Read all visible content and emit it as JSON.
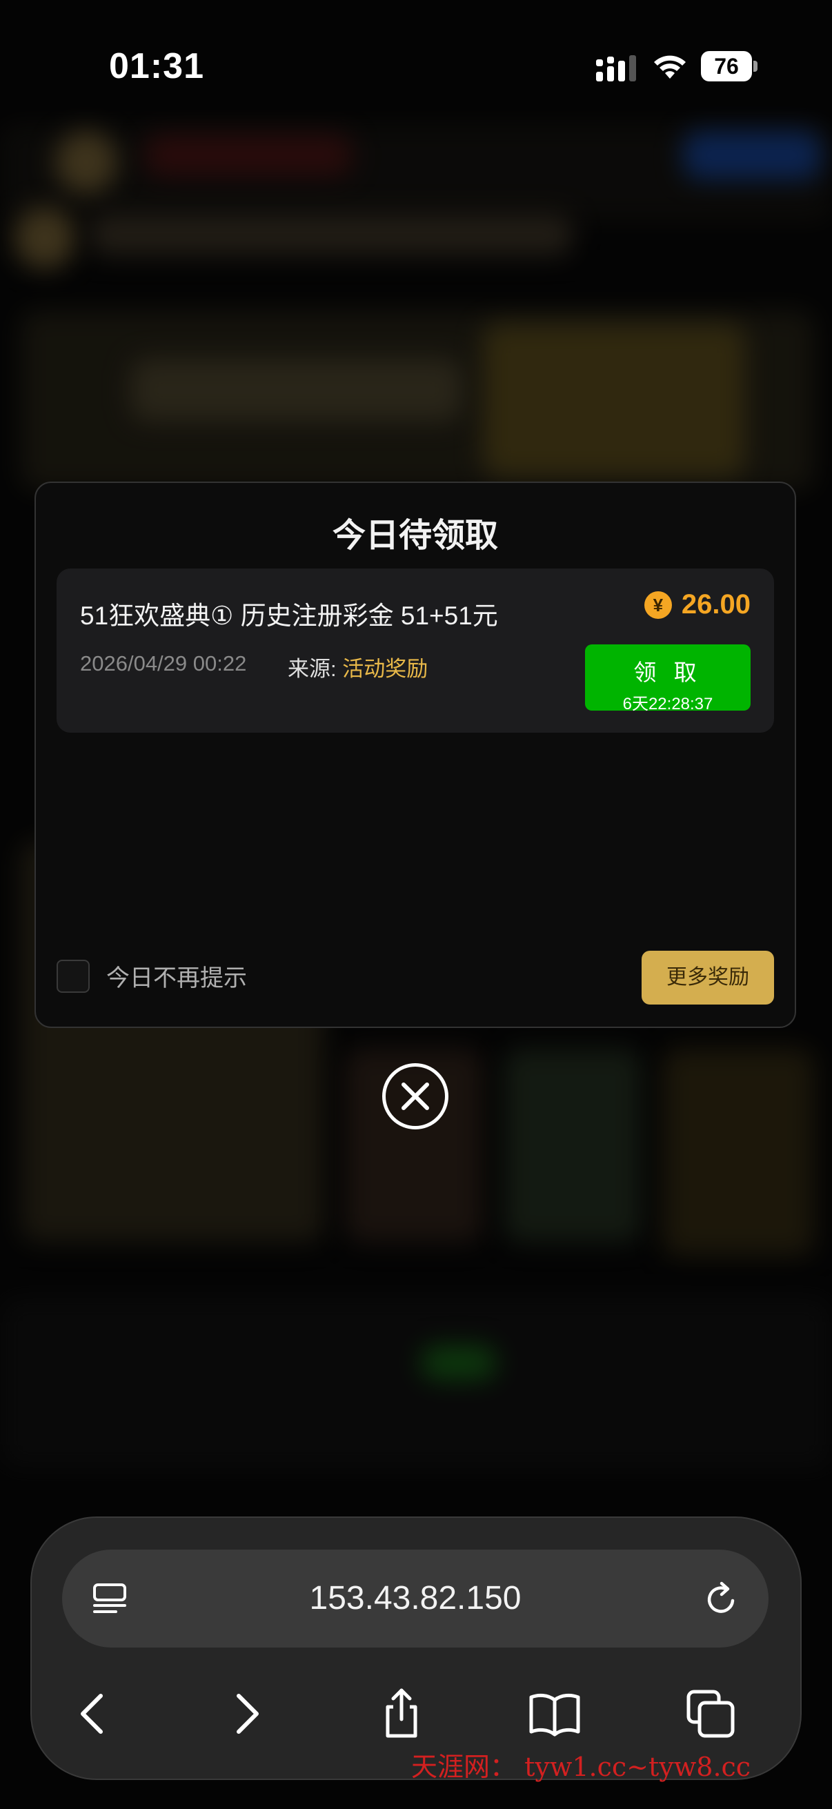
{
  "status_bar": {
    "time": "01:31",
    "battery": "76"
  },
  "modal": {
    "title": "今日待领取",
    "rewards": [
      {
        "title": "51狂欢盛典① 历史注册彩金 51+51元",
        "date": "2026/04/29 00:22",
        "source_label": "来源:",
        "source_value": "活动奖励",
        "amount": "26.00",
        "currency_icon": "¥",
        "claim_label": "领 取",
        "countdown": "6天22:28:37"
      }
    ],
    "dont_show_label": "今日不再提示",
    "more_rewards_label": "更多奖励"
  },
  "browser": {
    "url": "153.43.82.150"
  },
  "watermark": "天涯网： tyw1.cc~tyw8.cc",
  "colors": {
    "accent_gold": "#f5a623",
    "claim_green": "#00b400",
    "more_button": "#d4ae4f",
    "source_text": "#e9b949"
  },
  "icons": {
    "close": "close-icon",
    "reader": "reader-mode-icon",
    "reload": "reload-icon",
    "back": "back-icon",
    "forward": "forward-icon",
    "share": "share-icon",
    "bookmarks": "bookmarks-icon",
    "tabs": "tabs-icon"
  }
}
